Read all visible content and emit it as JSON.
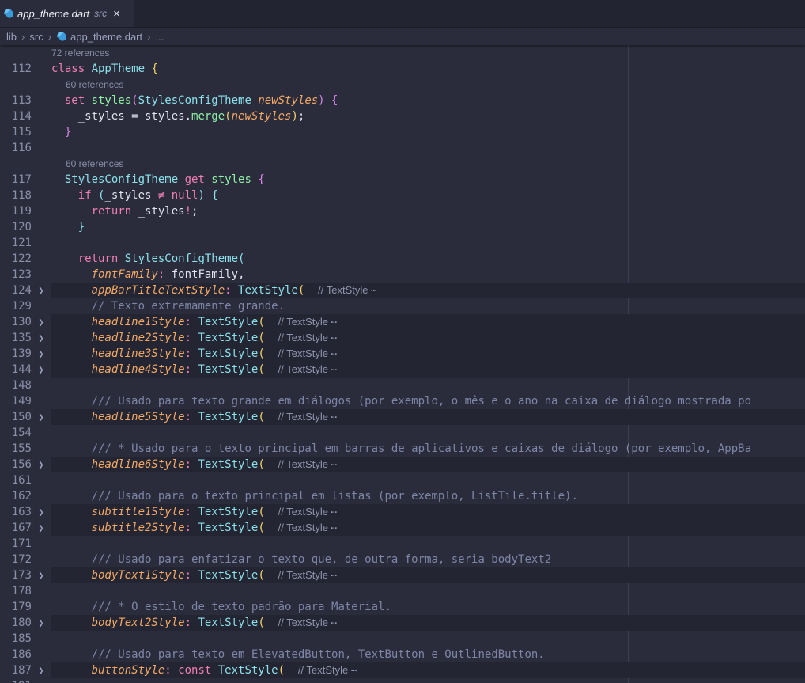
{
  "tab": {
    "filename": "app_theme.dart",
    "folder": "src",
    "close_icon": "×"
  },
  "breadcrumb": {
    "parts": [
      "lib",
      "src",
      "app_theme.dart",
      "..."
    ]
  },
  "editor": {
    "lines": [
      {
        "ref": "72 references",
        "indent": 0
      },
      {
        "ln": "112",
        "segs": [
          [
            "kw",
            "class "
          ],
          [
            "cls",
            "AppTheme "
          ],
          [
            "br",
            "{"
          ]
        ]
      },
      {
        "ref": "60 references",
        "indent": 2
      },
      {
        "ln": "113",
        "segs": [
          [
            "plain",
            "  "
          ],
          [
            "kw",
            "set "
          ],
          [
            "fn",
            "styles"
          ],
          [
            "br2",
            "("
          ],
          [
            "cls",
            "StylesConfigTheme "
          ],
          [
            "par",
            "newStyles"
          ],
          [
            "br2",
            ")"
          ],
          [
            "plain",
            " "
          ],
          [
            "br2",
            "{"
          ]
        ]
      },
      {
        "ln": "114",
        "segs": [
          [
            "plain",
            "    _styles = styles."
          ],
          [
            "fn",
            "merge"
          ],
          [
            "br",
            "("
          ],
          [
            "par",
            "newStyles"
          ],
          [
            "br",
            ")"
          ],
          [
            "plain",
            ";"
          ]
        ]
      },
      {
        "ln": "115",
        "segs": [
          [
            "plain",
            "  "
          ],
          [
            "br2",
            "}"
          ]
        ]
      },
      {
        "ln": "116",
        "segs": []
      },
      {
        "ref": "60 references",
        "indent": 2
      },
      {
        "ln": "117",
        "segs": [
          [
            "plain",
            "  "
          ],
          [
            "cls",
            "StylesConfigTheme "
          ],
          [
            "kw",
            "get "
          ],
          [
            "fn",
            "styles "
          ],
          [
            "br2",
            "{"
          ]
        ]
      },
      {
        "ln": "118",
        "segs": [
          [
            "plain",
            "    "
          ],
          [
            "kw",
            "if "
          ],
          [
            "cls",
            "("
          ],
          [
            "plain",
            "_styles "
          ],
          [
            "kw",
            "≠ "
          ],
          [
            "kw",
            "null"
          ],
          [
            "cls",
            ")"
          ],
          [
            "plain",
            " "
          ],
          [
            "cls",
            "{"
          ]
        ]
      },
      {
        "ln": "119",
        "segs": [
          [
            "plain",
            "      "
          ],
          [
            "kw",
            "return "
          ],
          [
            "plain",
            "_styles"
          ],
          [
            "kw",
            "!"
          ],
          [
            "plain",
            ";"
          ]
        ]
      },
      {
        "ln": "120",
        "segs": [
          [
            "plain",
            "    "
          ],
          [
            "cls",
            "}"
          ]
        ]
      },
      {
        "ln": "121",
        "segs": []
      },
      {
        "ln": "122",
        "segs": [
          [
            "plain",
            "    "
          ],
          [
            "kw",
            "return "
          ],
          [
            "cls",
            "StylesConfigTheme"
          ],
          [
            "cls",
            "("
          ]
        ]
      },
      {
        "ln": "123",
        "segs": [
          [
            "plain",
            "      "
          ],
          [
            "par",
            "fontFamily"
          ],
          [
            "kw",
            ": "
          ],
          [
            "plain",
            "fontFamily,"
          ]
        ]
      },
      {
        "ln": "124",
        "fold": true,
        "segs": [
          [
            "plain",
            "      "
          ],
          [
            "par",
            "appBarTitleTextStyle"
          ],
          [
            "kw",
            ": "
          ],
          [
            "cls",
            "TextStyle"
          ],
          [
            "br",
            "("
          ],
          [
            "plain",
            "  "
          ],
          [
            "fold",
            "// TextStyle "
          ],
          [
            "ell",
            "⋯"
          ]
        ]
      },
      {
        "ln": "129",
        "segs": [
          [
            "plain",
            "      "
          ],
          [
            "com",
            "// Texto extremamente grande."
          ]
        ]
      },
      {
        "ln": "130",
        "fold": true,
        "segs": [
          [
            "plain",
            "      "
          ],
          [
            "par",
            "headline1Style"
          ],
          [
            "kw",
            ": "
          ],
          [
            "cls",
            "TextStyle"
          ],
          [
            "br",
            "("
          ],
          [
            "plain",
            "  "
          ],
          [
            "fold",
            "// TextStyle "
          ],
          [
            "ell",
            "⋯"
          ]
        ]
      },
      {
        "ln": "135",
        "fold": true,
        "segs": [
          [
            "plain",
            "      "
          ],
          [
            "par",
            "headline2Style"
          ],
          [
            "kw",
            ": "
          ],
          [
            "cls",
            "TextStyle"
          ],
          [
            "br",
            "("
          ],
          [
            "plain",
            "  "
          ],
          [
            "fold",
            "// TextStyle "
          ],
          [
            "ell",
            "⋯"
          ]
        ]
      },
      {
        "ln": "139",
        "fold": true,
        "segs": [
          [
            "plain",
            "      "
          ],
          [
            "par",
            "headline3Style"
          ],
          [
            "kw",
            ": "
          ],
          [
            "cls",
            "TextStyle"
          ],
          [
            "br",
            "("
          ],
          [
            "plain",
            "  "
          ],
          [
            "fold",
            "// TextStyle "
          ],
          [
            "ell",
            "⋯"
          ]
        ]
      },
      {
        "ln": "144",
        "fold": true,
        "segs": [
          [
            "plain",
            "      "
          ],
          [
            "par",
            "headline4Style"
          ],
          [
            "kw",
            ": "
          ],
          [
            "cls",
            "TextStyle"
          ],
          [
            "br",
            "("
          ],
          [
            "plain",
            "  "
          ],
          [
            "fold",
            "// TextStyle "
          ],
          [
            "ell",
            "⋯"
          ]
        ]
      },
      {
        "ln": "148",
        "segs": []
      },
      {
        "ln": "149",
        "segs": [
          [
            "plain",
            "      "
          ],
          [
            "com",
            "/// Usado para texto grande em diálogos (por exemplo, o mês e o ano na caixa de diálogo mostrada po"
          ]
        ]
      },
      {
        "ln": "150",
        "fold": true,
        "segs": [
          [
            "plain",
            "      "
          ],
          [
            "par",
            "headline5Style"
          ],
          [
            "kw",
            ": "
          ],
          [
            "cls",
            "TextStyle"
          ],
          [
            "br",
            "("
          ],
          [
            "plain",
            "  "
          ],
          [
            "fold",
            "// TextStyle "
          ],
          [
            "ell",
            "⋯"
          ]
        ]
      },
      {
        "ln": "154",
        "segs": []
      },
      {
        "ln": "155",
        "segs": [
          [
            "plain",
            "      "
          ],
          [
            "com",
            "/// * Usado para o texto principal em barras de aplicativos e caixas de diálogo (por exemplo, AppBa"
          ]
        ]
      },
      {
        "ln": "156",
        "fold": true,
        "segs": [
          [
            "plain",
            "      "
          ],
          [
            "par",
            "headline6Style"
          ],
          [
            "kw",
            ": "
          ],
          [
            "cls",
            "TextStyle"
          ],
          [
            "br",
            "("
          ],
          [
            "plain",
            "  "
          ],
          [
            "fold",
            "// TextStyle "
          ],
          [
            "ell",
            "⋯"
          ]
        ]
      },
      {
        "ln": "161",
        "segs": []
      },
      {
        "ln": "162",
        "segs": [
          [
            "plain",
            "      "
          ],
          [
            "com",
            "/// Usado para o texto principal em listas (por exemplo, ListTile.title)."
          ]
        ]
      },
      {
        "ln": "163",
        "fold": true,
        "segs": [
          [
            "plain",
            "      "
          ],
          [
            "par",
            "subtitle1Style"
          ],
          [
            "kw",
            ": "
          ],
          [
            "cls",
            "TextStyle"
          ],
          [
            "br",
            "("
          ],
          [
            "plain",
            "  "
          ],
          [
            "fold",
            "// TextStyle "
          ],
          [
            "ell",
            "⋯"
          ]
        ]
      },
      {
        "ln": "167",
        "fold": true,
        "segs": [
          [
            "plain",
            "      "
          ],
          [
            "par",
            "subtitle2Style"
          ],
          [
            "kw",
            ": "
          ],
          [
            "cls",
            "TextStyle"
          ],
          [
            "br",
            "("
          ],
          [
            "plain",
            "  "
          ],
          [
            "fold",
            "// TextStyle "
          ],
          [
            "ell",
            "⋯"
          ]
        ]
      },
      {
        "ln": "171",
        "segs": []
      },
      {
        "ln": "172",
        "segs": [
          [
            "plain",
            "      "
          ],
          [
            "com",
            "/// Usado para enfatizar o texto que, de outra forma, seria bodyText2"
          ]
        ]
      },
      {
        "ln": "173",
        "fold": true,
        "segs": [
          [
            "plain",
            "      "
          ],
          [
            "par",
            "bodyText1Style"
          ],
          [
            "kw",
            ": "
          ],
          [
            "cls",
            "TextStyle"
          ],
          [
            "br",
            "("
          ],
          [
            "plain",
            "  "
          ],
          [
            "fold",
            "// TextStyle "
          ],
          [
            "ell",
            "⋯"
          ]
        ]
      },
      {
        "ln": "178",
        "segs": []
      },
      {
        "ln": "179",
        "segs": [
          [
            "plain",
            "      "
          ],
          [
            "com",
            "/// * O estilo de texto padrão para Material."
          ]
        ]
      },
      {
        "ln": "180",
        "fold": true,
        "segs": [
          [
            "plain",
            "      "
          ],
          [
            "par",
            "bodyText2Style"
          ],
          [
            "kw",
            ": "
          ],
          [
            "cls",
            "TextStyle"
          ],
          [
            "br",
            "("
          ],
          [
            "plain",
            "  "
          ],
          [
            "fold",
            "// TextStyle "
          ],
          [
            "ell",
            "⋯"
          ]
        ]
      },
      {
        "ln": "185",
        "segs": []
      },
      {
        "ln": "186",
        "segs": [
          [
            "plain",
            "      "
          ],
          [
            "com",
            "/// Usado para texto em ElevatedButton, TextButton e OutlinedButton."
          ]
        ]
      },
      {
        "ln": "187",
        "fold": true,
        "segs": [
          [
            "plain",
            "      "
          ],
          [
            "par",
            "buttonStyle"
          ],
          [
            "kw",
            ": "
          ],
          [
            "kw",
            "const "
          ],
          [
            "cls",
            "TextStyle"
          ],
          [
            "br",
            "("
          ],
          [
            "plain",
            "  "
          ],
          [
            "fold",
            "// TextStyle "
          ],
          [
            "ell",
            "⋯"
          ]
        ]
      },
      {
        "ln": "191",
        "segs": []
      }
    ]
  },
  "colors": {
    "background": "#2a2c3b",
    "tabbar": "#222431",
    "keyword": "#f07fb4",
    "class": "#8ce0ea",
    "function": "#8ff0a4",
    "parameter": "#f2a866",
    "comment": "#7e85a6"
  },
  "icons": {
    "file": "dart-icon",
    "fold": "chevron-right-icon",
    "close": "close-icon"
  }
}
